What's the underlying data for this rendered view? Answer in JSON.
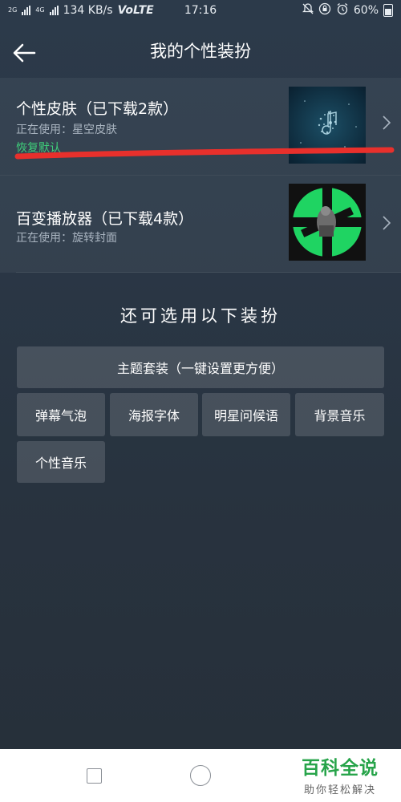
{
  "status_bar": {
    "network_left": "2G",
    "network_4g": "4G",
    "speed": "134 KB/s",
    "volte": "VoLTE",
    "time": "17:16",
    "battery": "60%"
  },
  "header": {
    "title": "我的个性装扮",
    "back_icon": "arrow-left-icon"
  },
  "skin": {
    "name": "个性皮肤（已下载2款）",
    "using": "正在使用：星空皮肤",
    "restore": "恢复默认",
    "thumb_colors": [
      "#0c2a3c",
      "#1c4f66"
    ]
  },
  "player": {
    "name": "百变播放器（已下载4款）",
    "using": "正在使用：旋转封面",
    "thumb_colors": [
      "#111111",
      "#1fd462"
    ]
  },
  "more": {
    "title": "还可选用以下装扮",
    "suite_label": "主题套装（一键设置更方便）",
    "options": [
      "弹幕气泡",
      "海报字体",
      "明星问候语",
      "背景音乐",
      "个性音乐"
    ]
  },
  "watermark": {
    "main": "百科全说",
    "sub": "助你轻松解决"
  },
  "colors": {
    "accent_green": "#3fcf7a",
    "annotation_red": "#e8302c"
  }
}
